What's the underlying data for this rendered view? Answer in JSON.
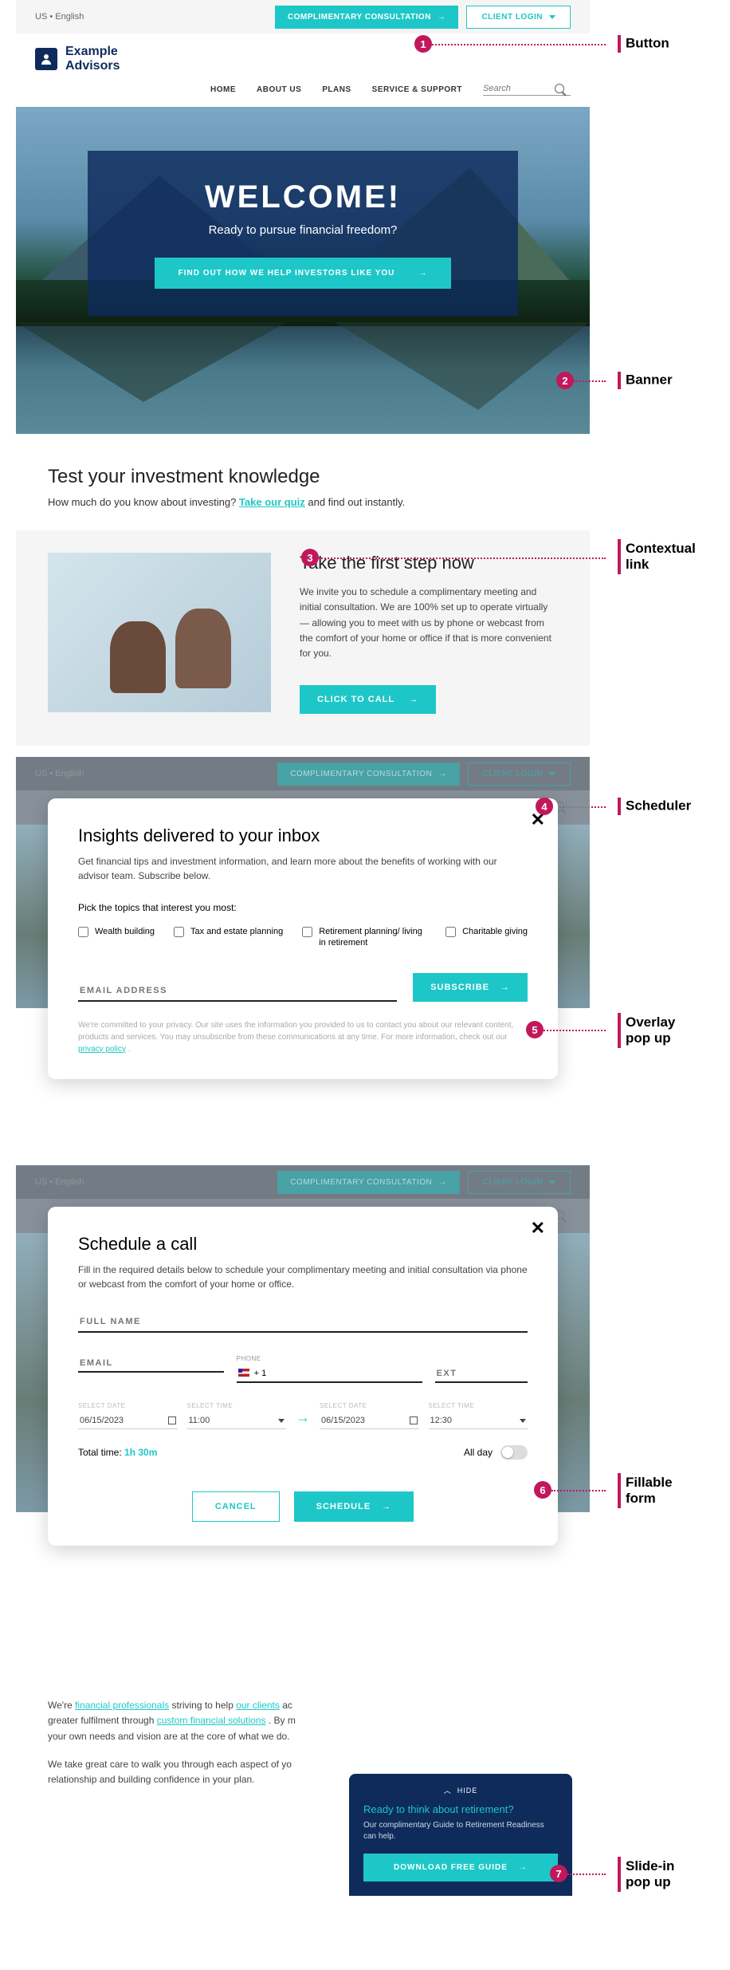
{
  "locale": "US • English",
  "topbar": {
    "consult": "COMPLIMENTARY CONSULTATION",
    "login": "CLIENT LOGIN"
  },
  "brand": {
    "line1": "Example",
    "line2": "Advisors"
  },
  "nav": {
    "home": "HOME",
    "about": "ABOUT US",
    "plans": "PLANS",
    "support": "SERVICE & SUPPORT"
  },
  "search_placeholder": "Search",
  "hero": {
    "title": "WELCOME!",
    "sub": "Ready to pursue financial freedom?",
    "cta": "FIND OUT HOW WE HELP INVESTORS LIKE YOU"
  },
  "quiz": {
    "title": "Test your investment knowledge",
    "pre": "How much do you know about investing? ",
    "link": "Take our quiz",
    "post": " and find out instantly."
  },
  "step": {
    "title": "Take the first step now",
    "body": "We invite you to schedule a complimentary meeting and initial consultation. We are 100% set up to operate virtually — allowing you to meet with us by phone or webcast from the comfort of your home or office if that is more convenient for you.",
    "cta": "CLICK TO CALL"
  },
  "insights": {
    "title": "Insights delivered to your inbox",
    "body": "Get financial tips and investment information, and learn more about the benefits of working with our advisor team. Subscribe below.",
    "pick": "Pick the topics that interest you most:",
    "topics": {
      "a": "Wealth building",
      "b": "Tax and estate planning",
      "c": "Retirement planning/ living in retirement",
      "d": "Charitable giving"
    },
    "email_ph": "EMAIL ADDRESS",
    "subscribe": "SUBSCRIBE",
    "privacy": "We're committed to your privacy. Our site uses the information you provided to us to contact you about our relevant content, products and services. You may unsubscribe from these communications at any time. For more information, check out our ",
    "privacy_link": "privacy policy"
  },
  "schedule": {
    "title": "Schedule a call",
    "body": "Fill in the required details below to schedule your complimentary meeting and initial consultation via phone or webcast from the comfort of your home or office.",
    "fullname_ph": "FULL NAME",
    "email_ph": "EMAIL",
    "phone_lbl": "PHONE",
    "phone_val": "+ 1",
    "ext_ph": "EXT",
    "sel_date": "SELECT DATE",
    "sel_time": "SELECT TIME",
    "date1": "06/15/2023",
    "time1": "11:00",
    "date2": "06/15/2023",
    "time2": "12:30",
    "total_lbl": "Total time:",
    "total_val": "1h 30m",
    "allday": "All day",
    "cancel": "CANCEL",
    "sched": "SCHEDULE"
  },
  "bodytext": {
    "p1a": "We're ",
    "p1b": "financial professionals",
    "p1c": " striving to help ",
    "p1d": "our clients",
    "p1e": " ac",
    "p1f": "greater fulfilment through ",
    "p1g": "custom financial solutions",
    "p1h": " . By m",
    "p1i": "your own needs and vision are at the core of what we do.",
    "p2": "We take great care to walk you through each aspect of yo",
    "p2b": "relationship and building confidence in your plan."
  },
  "slidein": {
    "hide": "HIDE",
    "title": "Ready to think about retirement?",
    "body": "Our complimentary Guide to Retirement Readiness can help.",
    "cta": "DOWNLOAD FREE GUIDE"
  },
  "labels": {
    "l1": "Button",
    "l2": "Banner",
    "l3a": "Contextual",
    "l3b": "link",
    "l4": "Scheduler",
    "l5a": "Overlay",
    "l5b": "pop up",
    "l6a": "Fillable",
    "l6b": "form",
    "l7a": "Slide-in",
    "l7b": "pop up"
  },
  "nums": {
    "n1": "1",
    "n2": "2",
    "n3": "3",
    "n4": "4",
    "n5": "5",
    "n6": "6",
    "n7": "7"
  }
}
